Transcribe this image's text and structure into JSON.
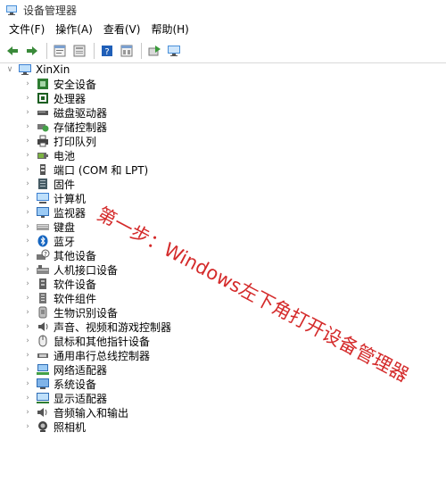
{
  "window": {
    "title": "设备管理器"
  },
  "menu": [
    "文件(F)",
    "操作(A)",
    "查看(V)",
    "帮助(H)"
  ],
  "toolbar": [
    "back-arrow-icon",
    "forward-arrow-icon",
    "properties-icon",
    "refresh-icon",
    "help-icon",
    "view-icon",
    "update-driver-icon",
    "scan-hardware-icon"
  ],
  "tree": {
    "root_label": "XinXin",
    "items": [
      {
        "label": "安全设备",
        "icon": "security-device-icon"
      },
      {
        "label": "处理器",
        "icon": "processor-icon"
      },
      {
        "label": "磁盘驱动器",
        "icon": "disk-drive-icon"
      },
      {
        "label": "存储控制器",
        "icon": "storage-controller-icon"
      },
      {
        "label": "打印队列",
        "icon": "printer-icon"
      },
      {
        "label": "电池",
        "icon": "battery-icon"
      },
      {
        "label": "端口 (COM 和 LPT)",
        "icon": "port-icon"
      },
      {
        "label": "固件",
        "icon": "firmware-icon"
      },
      {
        "label": "计算机",
        "icon": "computer-icon"
      },
      {
        "label": "监视器",
        "icon": "monitor-icon"
      },
      {
        "label": "键盘",
        "icon": "keyboard-icon"
      },
      {
        "label": "蓝牙",
        "icon": "bluetooth-icon"
      },
      {
        "label": "其他设备",
        "icon": "other-device-icon"
      },
      {
        "label": "人机接口设备",
        "icon": "hid-icon"
      },
      {
        "label": "软件设备",
        "icon": "software-device-icon"
      },
      {
        "label": "软件组件",
        "icon": "software-component-icon"
      },
      {
        "label": "生物识别设备",
        "icon": "biometric-icon"
      },
      {
        "label": "声音、视频和游戏控制器",
        "icon": "sound-icon"
      },
      {
        "label": "鼠标和其他指针设备",
        "icon": "mouse-icon"
      },
      {
        "label": "通用串行总线控制器",
        "icon": "usb-icon"
      },
      {
        "label": "网络适配器",
        "icon": "network-adapter-icon"
      },
      {
        "label": "系统设备",
        "icon": "system-device-icon"
      },
      {
        "label": "显示适配器",
        "icon": "display-adapter-icon"
      },
      {
        "label": "音频输入和输出",
        "icon": "audio-io-icon"
      },
      {
        "label": "照相机",
        "icon": "camera-icon"
      }
    ]
  },
  "annotation": {
    "text": "第一步：Windows左下角打开设备管理器",
    "color": "#d42a2a"
  }
}
